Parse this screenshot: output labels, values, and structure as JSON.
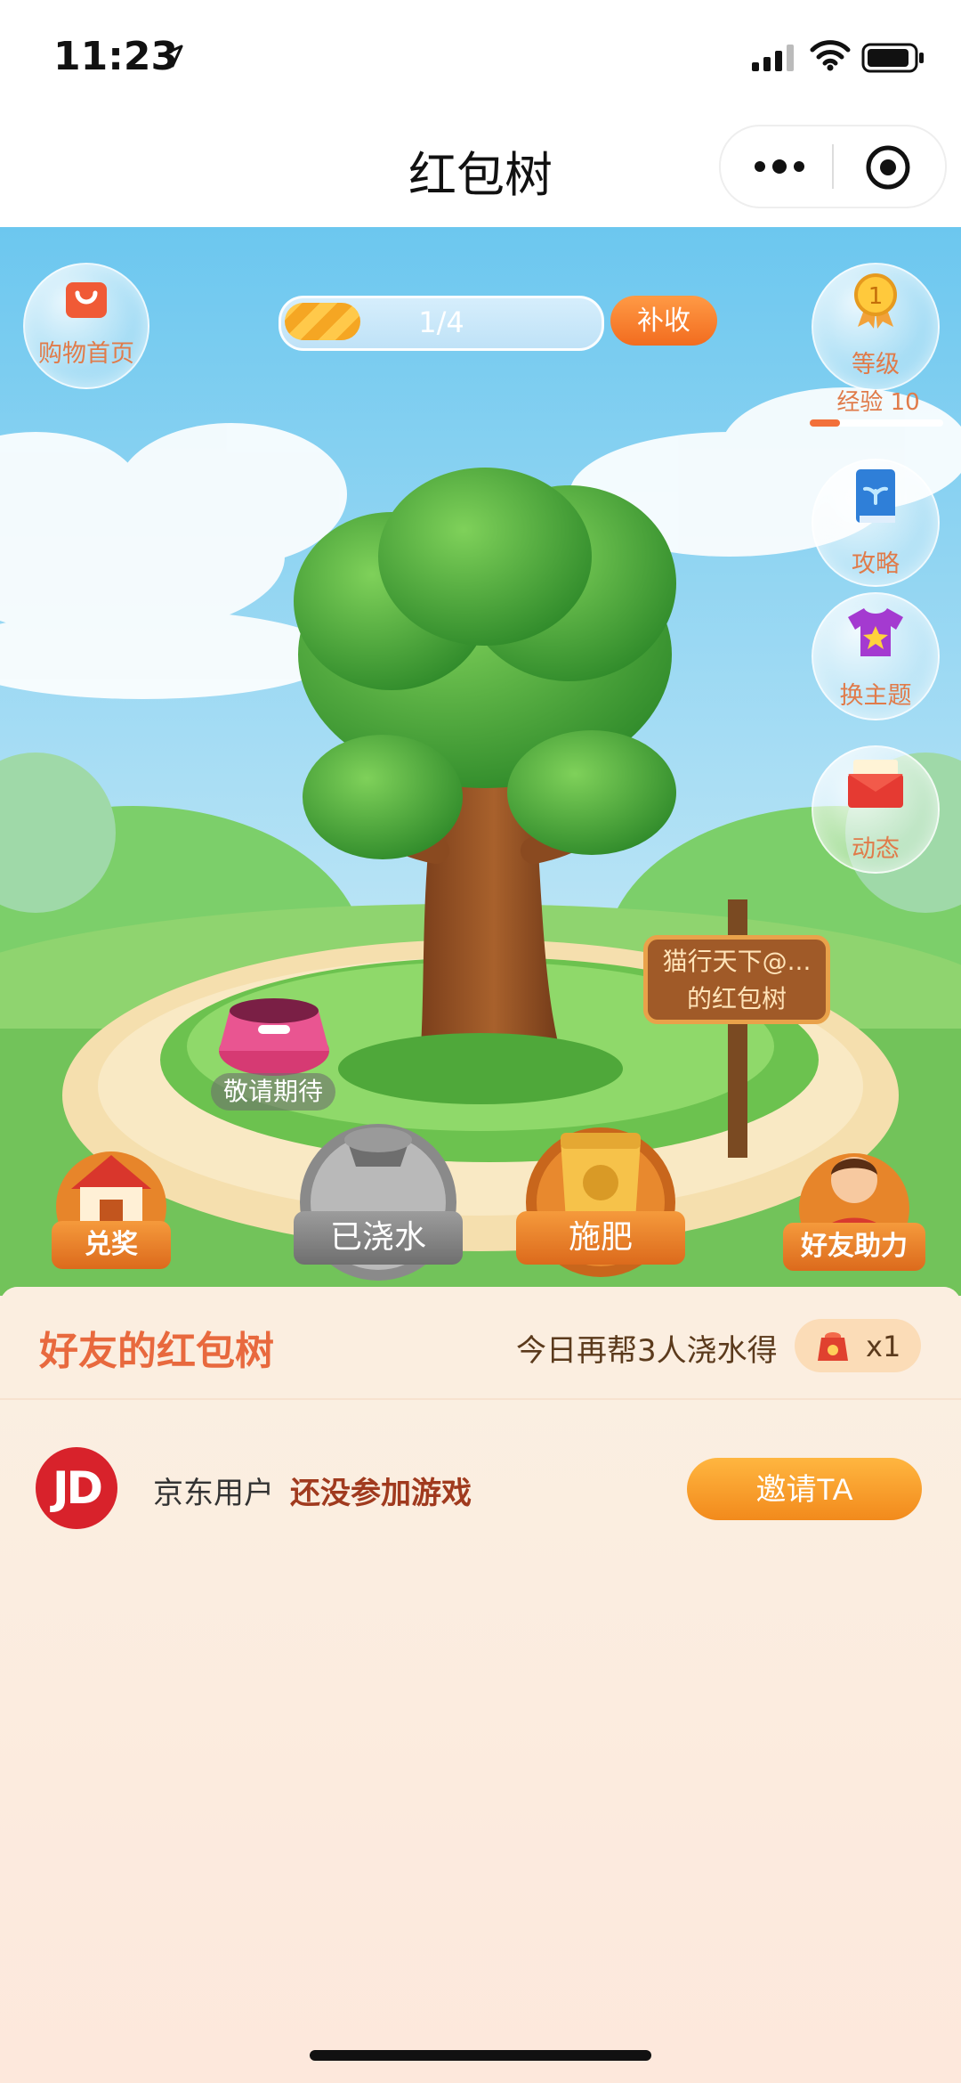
{
  "status_bar": {
    "time": "11:23"
  },
  "nav": {
    "title": "红包树"
  },
  "game": {
    "shop_home_label": "购物首页",
    "progress_text": "1/4",
    "progress_fraction": 0.25,
    "bushou_label": "补收",
    "level_badge": "1",
    "level_label": "等级",
    "exp_label": "经验 10",
    "strategy_label": "攻略",
    "theme_label": "换主题",
    "activity_label": "动态",
    "sign_line1": "猫行天下@...",
    "sign_line2": "的红包树",
    "bowl_label": "敬请期待",
    "redeem_label": "兑奖",
    "watered_label": "已浇水",
    "fertilize_label": "施肥",
    "friend_help_label": "好友助力"
  },
  "friends_panel": {
    "title": "好友的红包树",
    "tip": "今日再帮3人浇水得",
    "reward_count": "x1",
    "rows": [
      {
        "avatar": "JD",
        "name": "京东用户",
        "status": "还没参加游戏",
        "action": "邀请TA"
      }
    ]
  }
}
